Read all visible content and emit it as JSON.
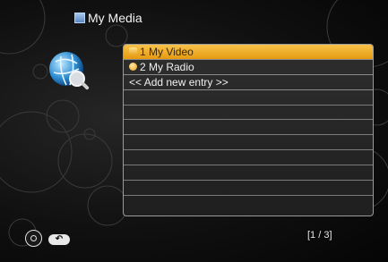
{
  "header": {
    "title": "My Media",
    "icon": "media-icon"
  },
  "list": {
    "items": [
      {
        "label": "1 My Video",
        "icon": "video-folder-icon",
        "selected": true
      },
      {
        "label": "2 My Radio",
        "icon": "radio-icon",
        "selected": false
      },
      {
        "label": "<< Add new entry >>",
        "icon": "",
        "selected": false
      }
    ],
    "empty_rows": 8
  },
  "footer": {
    "page_indicator": "[1 / 3]"
  },
  "colors": {
    "highlight": "#f0aa25",
    "background": "#0b0b0b",
    "panel_border": "#9a9a9a"
  }
}
